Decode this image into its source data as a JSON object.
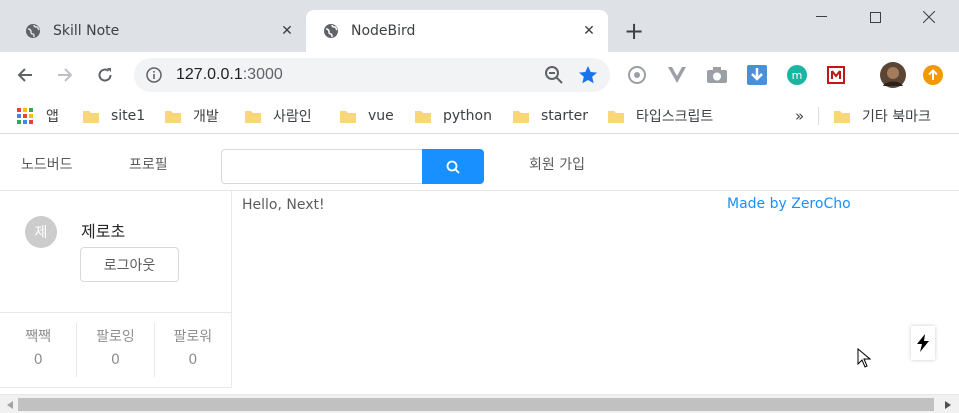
{
  "browser": {
    "tabs": [
      {
        "title": "Skill Note",
        "active": false
      },
      {
        "title": "NodeBird",
        "active": true
      }
    ],
    "new_tab_symbol": "+",
    "close_symbol": "✕",
    "address": {
      "host": "127.0.0.1",
      "port": ":3000"
    },
    "bookmarks": {
      "apps_label": "앱",
      "items": [
        "site1",
        "개발",
        "사람인",
        "vue",
        "python",
        "starter",
        "타입스크립트"
      ],
      "overflow": "»",
      "other": "기타 북마크"
    },
    "colors": {
      "tabstrip": "#dee1e6",
      "star": "#1a73e8",
      "folder": "#f9d67a"
    }
  },
  "app": {
    "menu": {
      "home": "노드버드",
      "profile": "프로필",
      "signup": "회원 가입"
    },
    "search": {
      "placeholder": "",
      "value": ""
    },
    "profile_card": {
      "avatar_initial": "제",
      "nickname": "제로초",
      "logout_label": "로그아웃",
      "stats": [
        {
          "label": "짹짹",
          "value": "0"
        },
        {
          "label": "팔로잉",
          "value": "0"
        },
        {
          "label": "팔로워",
          "value": "0"
        }
      ]
    },
    "main_text": "Hello, Next!",
    "made_by": "Made by ZeroCho",
    "colors": {
      "primary": "#1890ff"
    }
  }
}
